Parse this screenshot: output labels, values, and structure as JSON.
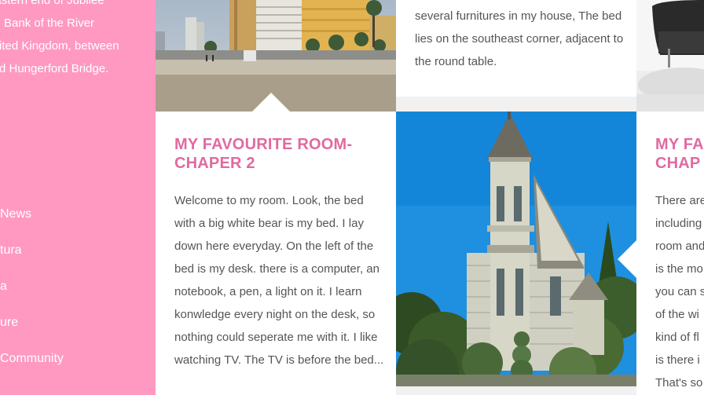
{
  "sidebar": {
    "description_lines": [
      "the eastern end of Jubilee",
      "Bank of the River",
      "ited Kingdom, between",
      "d Hungerford Bridge."
    ],
    "nav_items": [
      {
        "label": "News"
      },
      {
        "label": "tura"
      },
      {
        "label": "a"
      },
      {
        "label": "ure"
      },
      {
        "label": "Community"
      }
    ]
  },
  "posts": {
    "top_middle": {
      "body": "several furnitures in my house, The bed lies on the southeast corner, adjacent to the round table."
    },
    "main": {
      "title": "MY FAVOURITE ROOM-CHAPER 2",
      "body": "Welcome to my room. Look, the bed with a big white bear is my bed. I lay down here everyday. On the left of the bed is my desk. there is a computer, an notebook, a pen, a light on it. I learn konwledge every night on the desk, so nothing could seperate me with it. I like watching TV. The TV is before the bed..."
    },
    "right": {
      "title_lines": [
        "MY FA",
        "CHAP"
      ],
      "body_lines": [
        "There are",
        "including",
        "room and",
        "is the mo",
        "you can s",
        "of the wi",
        "kind of fl",
        "is there i",
        "That's so"
      ]
    }
  },
  "colors": {
    "sidebar_bg": "#ff99c1",
    "title": "#e06aa0",
    "body_text": "#555555",
    "page_bg": "#f1f1f1"
  }
}
